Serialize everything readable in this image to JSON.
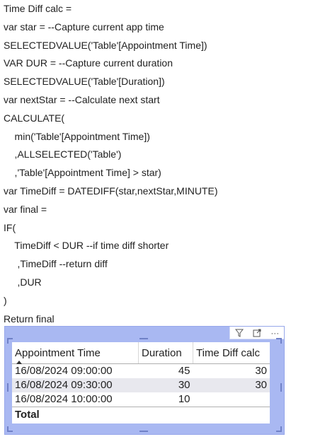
{
  "code_lines": [
    "Time Diff calc =",
    "var star = --Capture current app time",
    "SELECTEDVALUE('Table'[Appointment Time])",
    "VAR DUR = --Capture current duration",
    "SELECTEDVALUE('Table'[Duration])",
    "var nextStar = --Calculate next start",
    "CALCULATE(",
    "    min('Table'[Appointment Time])",
    "    ,ALLSELECTED('Table')",
    "    ,'Table'[Appointment Time] > star)",
    "var TimeDiff = DATEDIFF(star,nextStar,MINUTE)",
    "var final =",
    "IF(",
    "    TimeDiff < DUR --if time diff shorter",
    "     ,TimeDiff --return diff",
    "     ,DUR",
    ")",
    "Return final"
  ],
  "visual_header": {
    "icons": [
      "filter-icon",
      "focus-mode-icon",
      "more-options-icon"
    ],
    "more_glyph": "···"
  },
  "table": {
    "headers": [
      "Appointment Time",
      "Duration",
      "Time Diff calc"
    ],
    "rows": [
      [
        "16/08/2024 09:00:00",
        "45",
        "30"
      ],
      [
        "16/08/2024 09:30:00",
        "30",
        "30"
      ],
      [
        "16/08/2024 10:00:00",
        "10",
        ""
      ]
    ],
    "total_label": "Total"
  },
  "colors": {
    "visual_background": "#a9b8f2",
    "row_alt": "#e8e8ee"
  }
}
